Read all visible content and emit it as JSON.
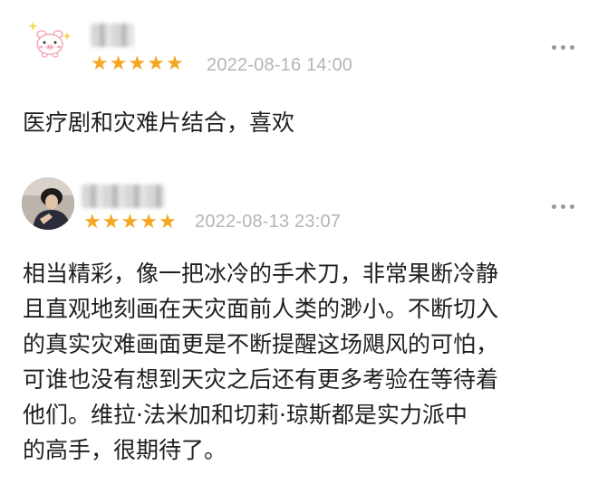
{
  "reviews": [
    {
      "avatar_icon": "pig-cartoon-avatar",
      "stars": "★★★★★",
      "rating": 5,
      "timestamp": "2022-08-16 14:00",
      "text": "医疗剧和灾难片结合，喜欢"
    },
    {
      "avatar_icon": "person-photo-avatar",
      "stars": "★★★★★",
      "rating": 5,
      "timestamp": "2022-08-13 23:07",
      "lines": [
        "相当精彩，像一把冰冷的手术刀，非常果断冷静",
        "且直观地刻画在天灾面前人类的渺小。不断切入",
        "的真实灾难画面更是不断提醒这场飓风的可怕，",
        "可谁也没有想到天灾之后还有更多考验在等待着",
        "他们。维拉·法米加和切莉·琼斯都是实力派中",
        "的高手，很期待了。"
      ]
    }
  ],
  "colors": {
    "star": "#f5a623",
    "timestamp": "#b5b5b5",
    "menu_dots": "#999999"
  },
  "icons": {
    "more": "more-dots-icon",
    "star": "star-icon"
  }
}
